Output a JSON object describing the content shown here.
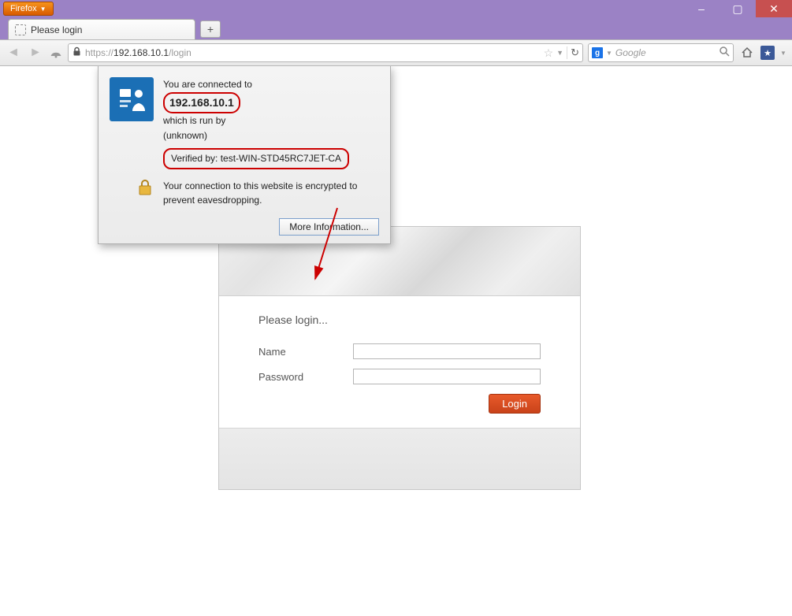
{
  "window": {
    "menu_label": "Firefox",
    "min": "–",
    "max": "▢",
    "close": "✕"
  },
  "tabs": {
    "active_title": "Please login",
    "newtab": "+"
  },
  "nav": {
    "url_scheme": "https://",
    "url_host": "192.168.10.1",
    "url_path": "/login",
    "search_provider_glyph": "g",
    "search_placeholder": "Google"
  },
  "identity": {
    "connected_to": "You are connected to",
    "domain": "192.168.10.1",
    "run_by": "which is run by",
    "org": "(unknown)",
    "verified_by": "Verified by: test-WIN-STD45RC7JET-CA",
    "encrypted": "Your connection to this website is encrypted to prevent eavesdropping.",
    "more_btn": "More Information..."
  },
  "login": {
    "title": "Please login...",
    "name_label": "Name",
    "password_label": "Password",
    "button": "Login"
  }
}
